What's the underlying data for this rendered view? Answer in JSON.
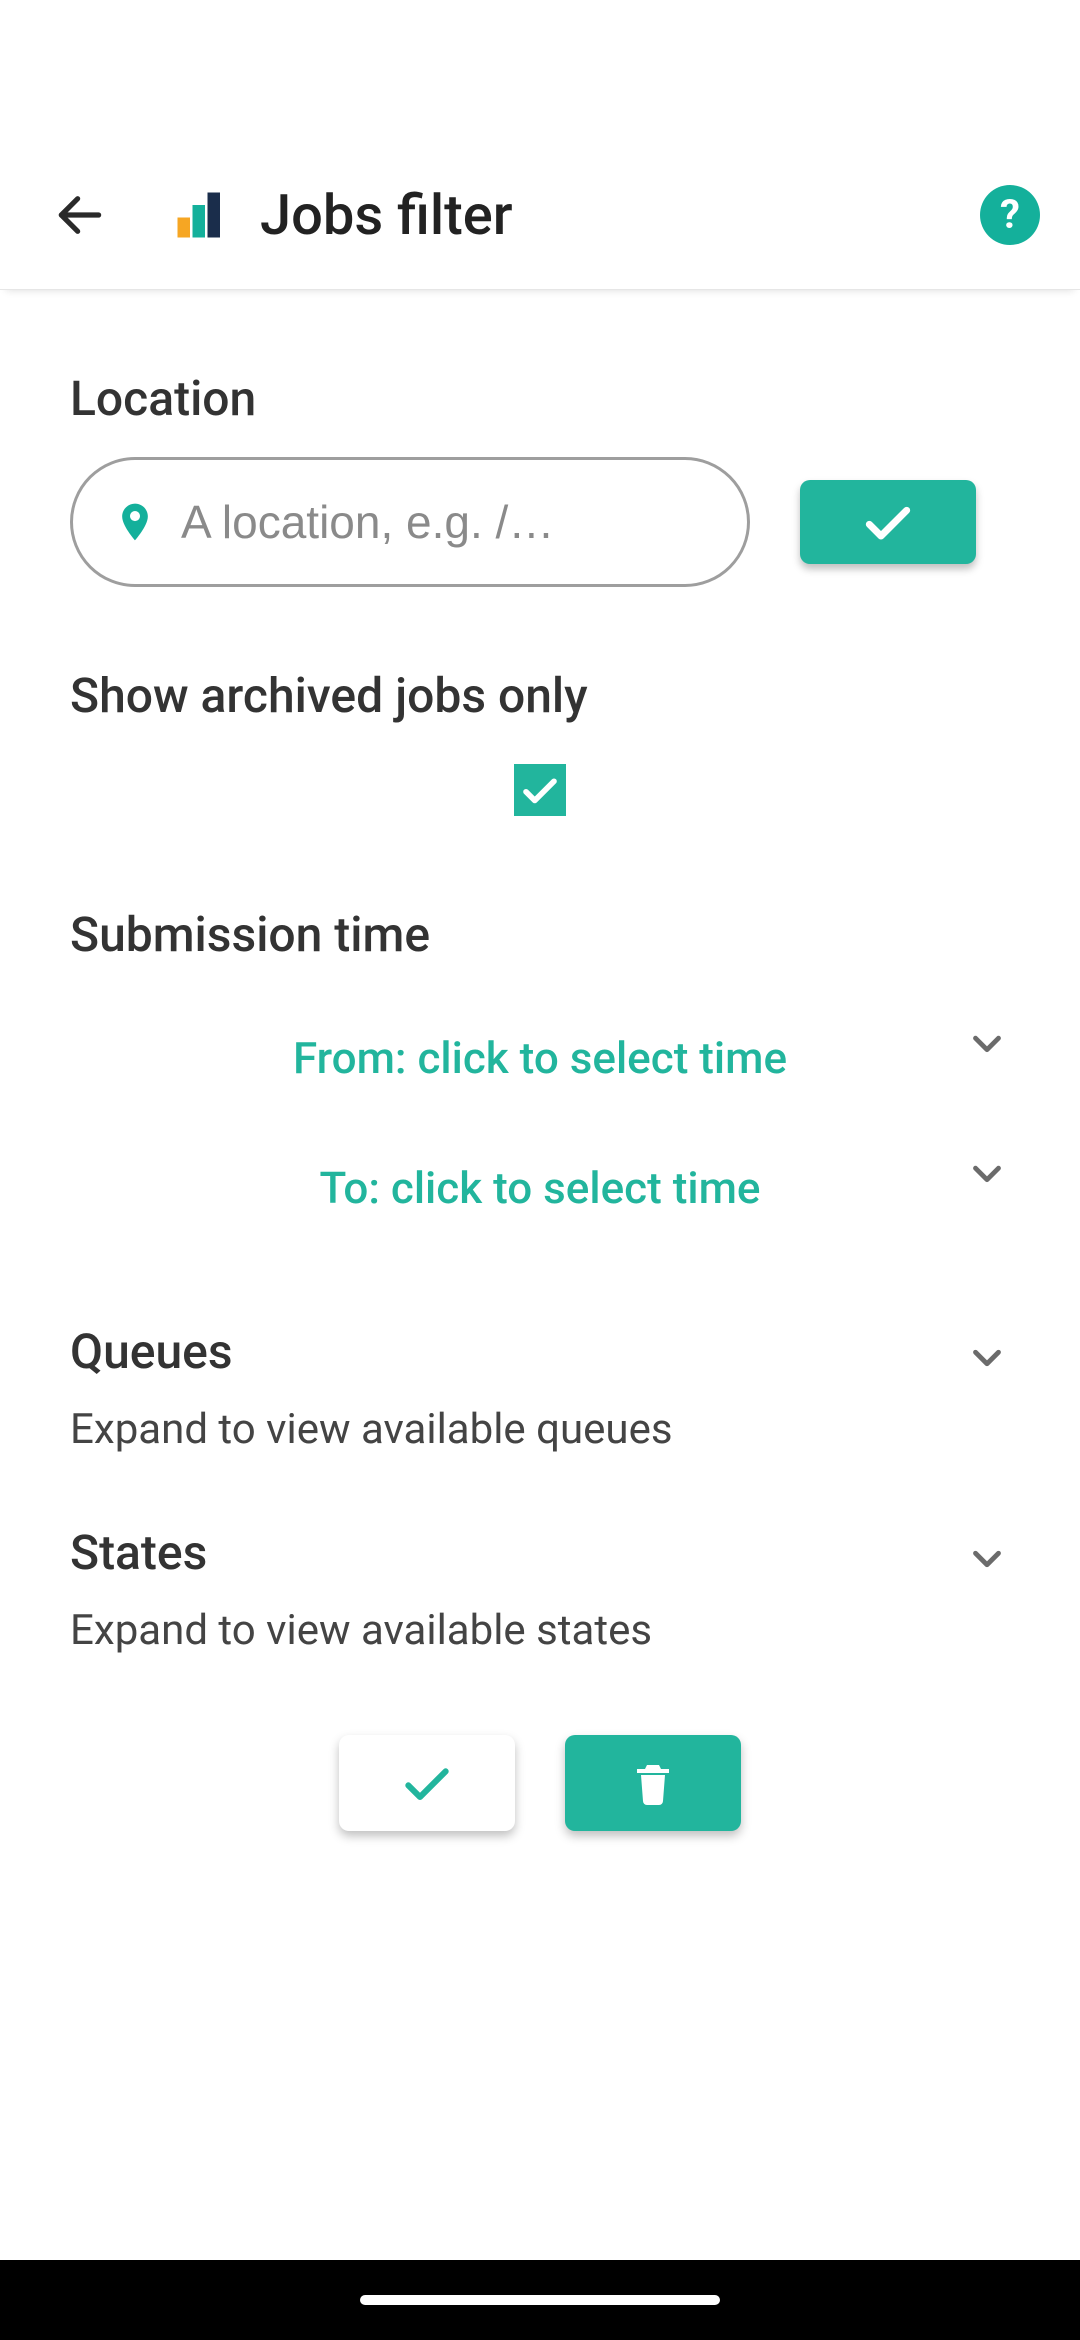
{
  "header": {
    "title": "Jobs filter"
  },
  "location": {
    "label": "Location",
    "placeholder": "A location, e.g. /…"
  },
  "archived": {
    "label": "Show archived jobs only",
    "checked": true
  },
  "submission": {
    "label": "Submission time",
    "from_label": "From: click to select time",
    "to_label": "To: click to select time"
  },
  "queues": {
    "title": "Queues",
    "sub": "Expand to view available queues"
  },
  "states": {
    "title": "States",
    "sub": "Expand to view available states"
  },
  "colors": {
    "accent": "#22b59d"
  }
}
